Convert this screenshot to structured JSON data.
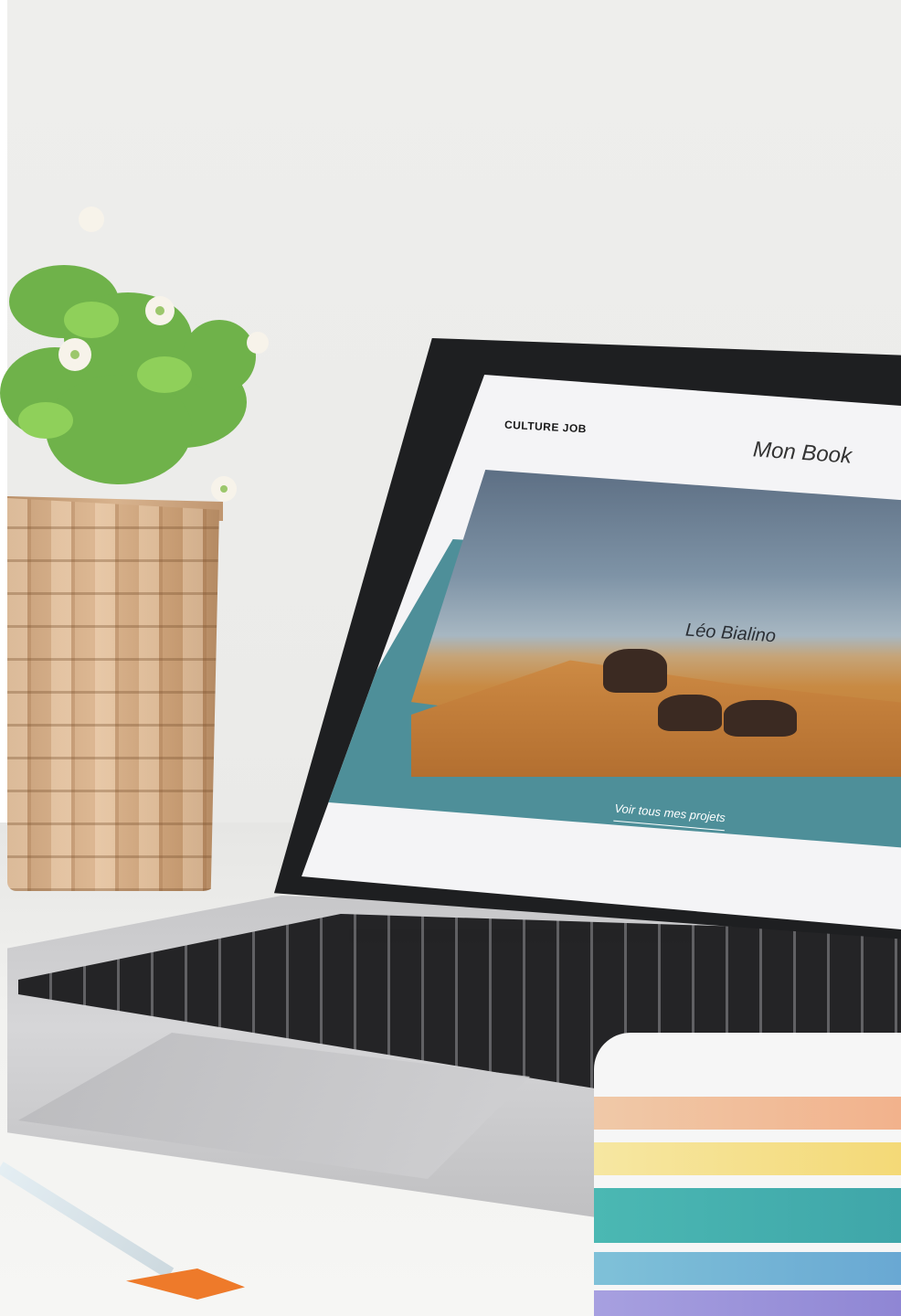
{
  "scene": {
    "website": {
      "brand": "CULTURE JOB",
      "page_title": "Mon Book",
      "hero_name": "Léo Bialino",
      "cta_label": "Voir tous mes projets"
    },
    "colors": {
      "teal_band": "#4e8f99",
      "screen_bg": "#f4f4f6",
      "cta_text": "#ffffff"
    },
    "objects": [
      "plant-in-basket",
      "laptop",
      "color-swatch-fan",
      "paint-brush"
    ]
  }
}
